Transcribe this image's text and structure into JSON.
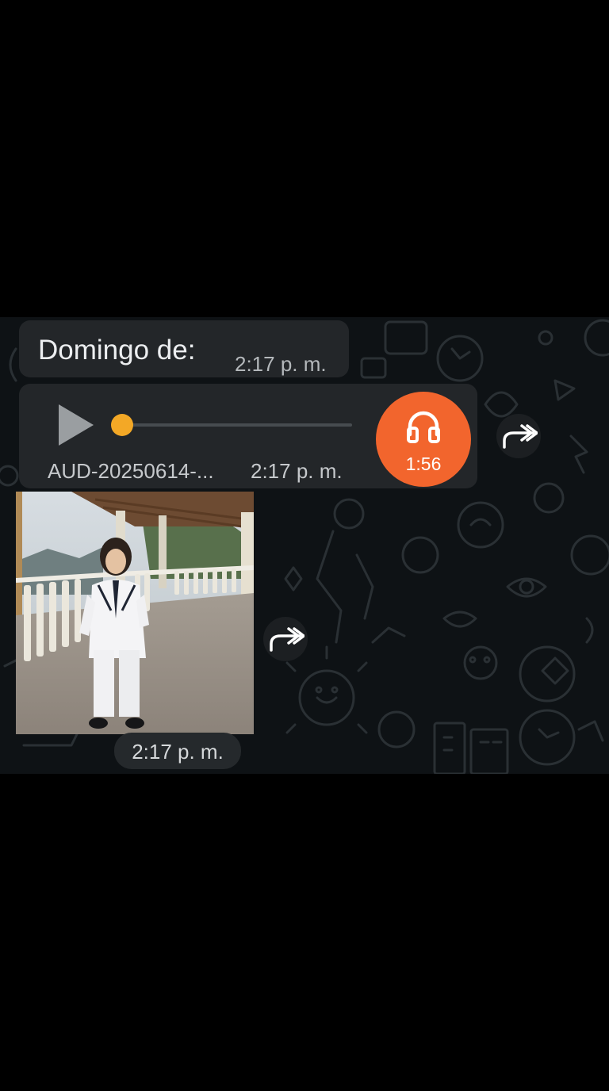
{
  "messages": {
    "text": {
      "body": "Domingo de:",
      "time": "2:17 p. m."
    },
    "audio": {
      "filename": "AUD-20250614-...",
      "time": "2:17 p. m.",
      "duration": "1:56",
      "progress": 0.0
    },
    "image": {
      "time": "2:17 p. m."
    }
  },
  "colors": {
    "chat_background": "#0e1215",
    "bubble": "#232629",
    "seek_knob": "#f3a826",
    "headphone_badge": "#f2652d"
  },
  "icons": {
    "play": "play-icon",
    "headphones": "headphones-icon",
    "forward": "forward-icon"
  }
}
